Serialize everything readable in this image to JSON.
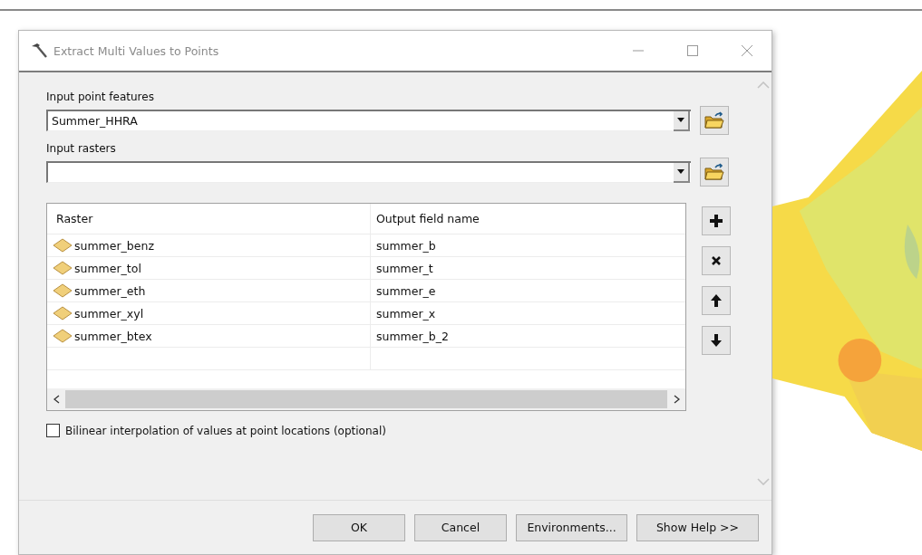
{
  "window": {
    "title": "Extract Multi Values to Points"
  },
  "input_point_features": {
    "label": "Input point features",
    "value": "Summer_HHRA"
  },
  "input_rasters": {
    "label": "Input rasters"
  },
  "table": {
    "columns": [
      "Raster",
      "Output field name"
    ],
    "rows": [
      {
        "raster": "summer_benz",
        "output_field_name": "summer_b"
      },
      {
        "raster": "summer_tol",
        "output_field_name": "summer_t"
      },
      {
        "raster": "summer_eth",
        "output_field_name": "summer_e"
      },
      {
        "raster": "summer_xyl",
        "output_field_name": "summer_x"
      },
      {
        "raster": "summer_btex",
        "output_field_name": "summer_b_2"
      }
    ]
  },
  "table_actions": [
    {
      "kind": "add"
    },
    {
      "kind": "remove"
    },
    {
      "kind": "up"
    },
    {
      "kind": "down"
    }
  ],
  "bilinear_option": {
    "label": "Bilinear interpolation of values at point locations (optional)",
    "checked": false
  },
  "buttons": [
    "OK",
    "Cancel",
    "Environments...",
    "Show Help >>"
  ]
}
